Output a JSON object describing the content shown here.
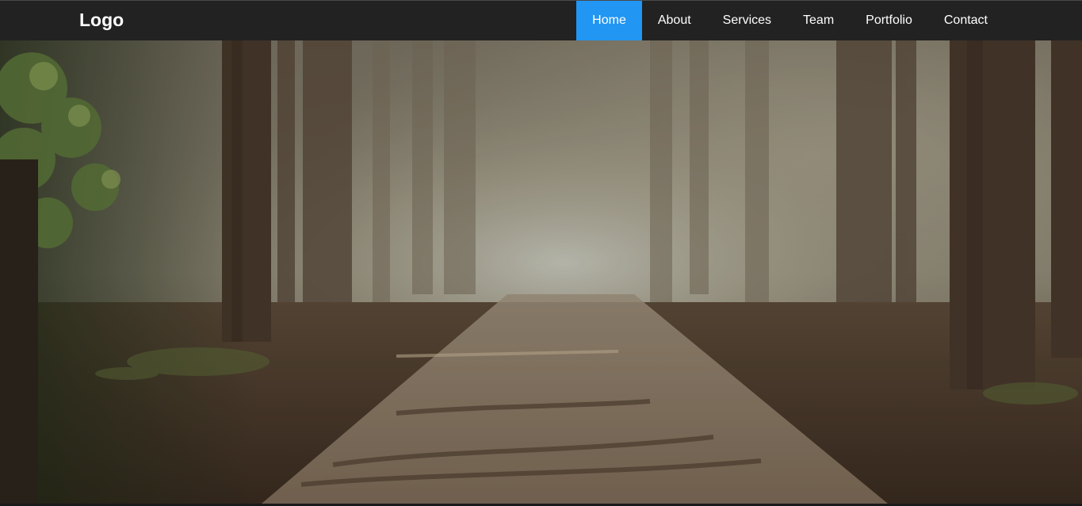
{
  "navbar": {
    "logo": "Logo",
    "items": [
      {
        "label": "Home",
        "active": true
      },
      {
        "label": "About",
        "active": false
      },
      {
        "label": "Services",
        "active": false
      },
      {
        "label": "Team",
        "active": false
      },
      {
        "label": "Portfolio",
        "active": false
      },
      {
        "label": "Contact",
        "active": false
      }
    ]
  },
  "colors": {
    "navbar_bg": "#222222",
    "active_item_bg": "#2196f3",
    "nav_text": "#ffffff"
  },
  "hero": {
    "image": "forest-path-photo"
  }
}
